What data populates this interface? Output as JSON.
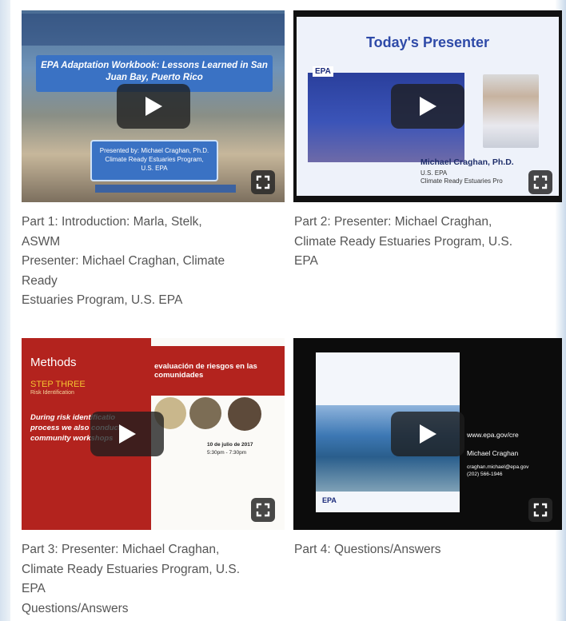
{
  "videos": [
    {
      "id": 1,
      "caption_lines": [
        "Part 1: Introduction: Marla, Stelk,",
        "ASWM",
        "Presenter: Michael Craghan, Climate",
        "Ready",
        "Estuaries Program, U.S. EPA"
      ],
      "slide": {
        "subtitle": "EPA Adaptation Workbook: Lessons Learned in San Juan Bay, Puerto Rico",
        "presenter_box": "Presented by: Michael Craghan, Ph.D. Climate Ready Estuaries Program, U.S. EPA"
      }
    },
    {
      "id": 2,
      "caption_lines": [
        "Part 2: Presenter: Michael Craghan,",
        "Climate Ready Estuaries Program, U.S.",
        "EPA"
      ],
      "slide": {
        "heading": "Today's Presenter",
        "logo": "EPA",
        "name": "Michael Craghan, Ph.D.",
        "line2": "U.S. EPA",
        "line3": "Climate Ready Estuaries Pro"
      }
    },
    {
      "id": 3,
      "caption_lines": [
        "Part 3: Presenter: Michael Craghan,",
        "Climate Ready Estuaries Program, U.S.",
        "EPA",
        "Questions/Answers"
      ],
      "slide": {
        "heading": "Methods",
        "step": "STEP THREE",
        "step_sub": "Risk Identification",
        "body1": "During risk identificatio",
        "body2": "process we also conduct",
        "body3": "community workshops",
        "poster_title": "evaluación de riesgos en las comunidades",
        "poster_date": "10 de julio de 2017",
        "poster_time": "5:30pm - 7:30pm"
      }
    },
    {
      "id": 4,
      "caption_lines": [
        "Part 4: Questions/Answers"
      ],
      "slide": {
        "url": "www.epa.gov/cre",
        "name": "Michael Craghan",
        "email": "craghan.michael@epa.gov",
        "phone": "(202) 566-1946",
        "logo": "EPA"
      }
    }
  ],
  "colors": {
    "caption_text": "#555555",
    "slide2_heading": "#2e4aa8",
    "slide3_red": "#b3231e",
    "slide3_yellow": "#f4c230"
  },
  "icons": [
    "play-icon",
    "fullscreen-icon"
  ]
}
